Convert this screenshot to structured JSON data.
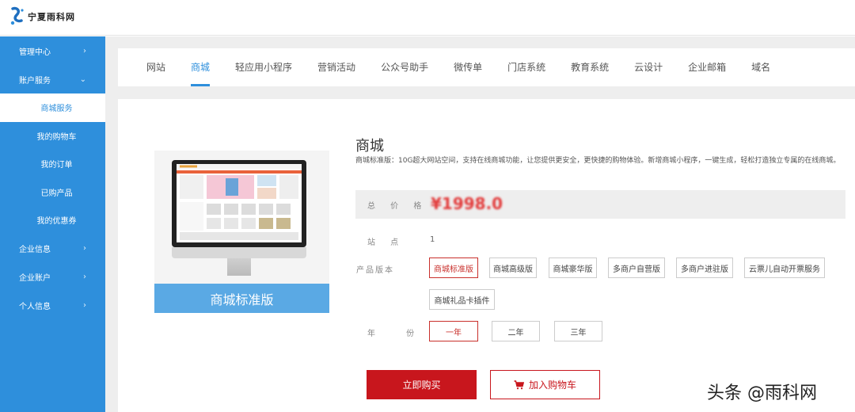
{
  "brand": {
    "name": "宁夏雨科网"
  },
  "sidebar": {
    "items": [
      {
        "label": "管理中心",
        "chevron": "›"
      },
      {
        "label": "账户服务",
        "chevron": "⌄"
      }
    ],
    "sub_items": [
      {
        "label": "商城服务"
      },
      {
        "label": "我的购物车"
      },
      {
        "label": "我的订单"
      },
      {
        "label": "已购产品"
      },
      {
        "label": "我的优惠券"
      }
    ],
    "bottom_items": [
      {
        "label": "企业信息",
        "chevron": "›"
      },
      {
        "label": "企业账户",
        "chevron": "›"
      },
      {
        "label": "个人信息",
        "chevron": "›"
      }
    ]
  },
  "tabs": [
    "网站",
    "商城",
    "轻应用小程序",
    "营销活动",
    "公众号助手",
    "微传单",
    "门店系统",
    "教育系统",
    "云设计",
    "企业邮箱",
    "域名"
  ],
  "product": {
    "image_caption": "商城标准版",
    "title": "商城",
    "description": "商城标准版：10G超大网站空间，支持在线商城功能，让您提供更安全，更快捷的购物体验。新增商城小程序，一键生成，轻松打造独立专属的在线商城。",
    "price_label": "总 价 格",
    "price": "¥1998.0",
    "site_label": "站 点",
    "site_value": "1",
    "version_label": "产品版本",
    "versions": [
      "商城标准版",
      "商城高级版",
      "商城豪华版",
      "多商户自营版",
      "多商户进驻版",
      "云票儿自动开票服务",
      "商城礼品卡插件"
    ],
    "year_label": "年 份",
    "years": [
      "一年",
      "二年",
      "三年"
    ],
    "buy_label": "立即购买",
    "cart_label": "加入购物车"
  },
  "watermark": "头条 @雨科网",
  "colors": {
    "sidebar": "#2e8fdc",
    "accent": "#2e8fdc",
    "buy": "#c8161d",
    "price": "#e23b3b"
  },
  "icons": {
    "cart": "cart-icon",
    "logo": "logo-mark-icon"
  }
}
